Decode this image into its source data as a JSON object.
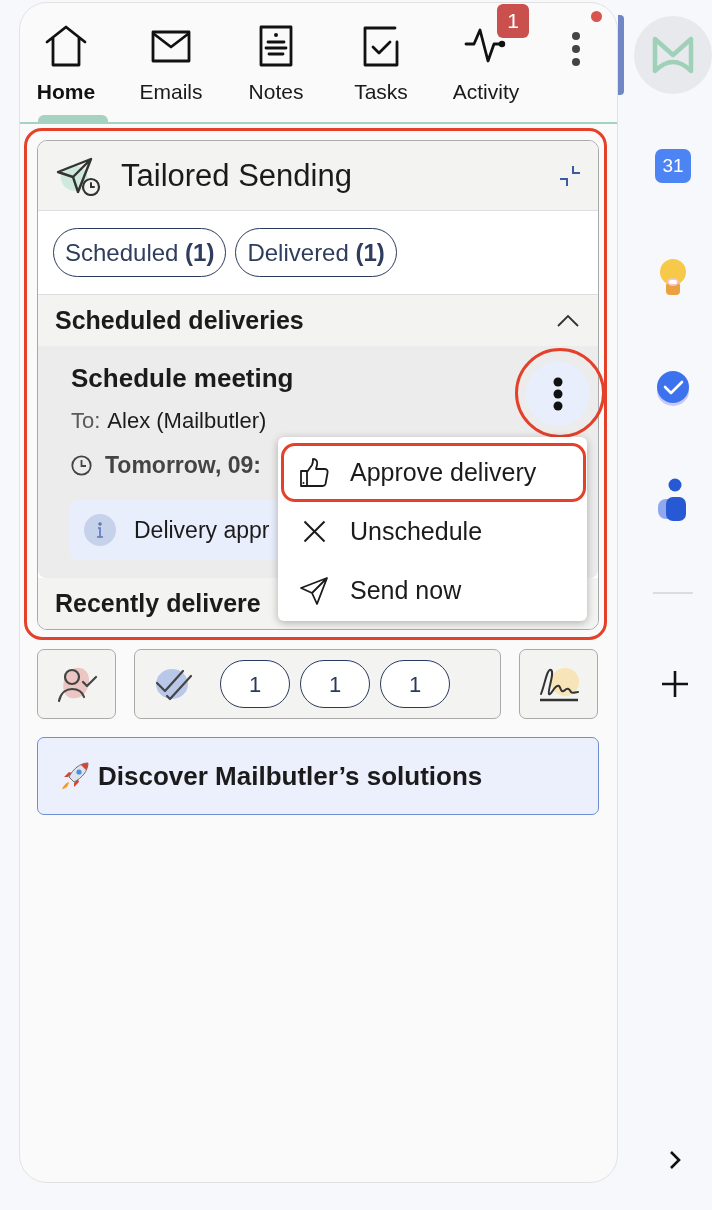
{
  "nav": {
    "tabs": [
      {
        "label": "Home",
        "selected": true
      },
      {
        "label": "Emails",
        "selected": false
      },
      {
        "label": "Notes",
        "selected": false
      },
      {
        "label": "Tasks",
        "selected": false
      },
      {
        "label": "Activity",
        "selected": false,
        "badge": "1"
      }
    ],
    "more_button": {
      "notification_dot": true
    }
  },
  "tailored_sending": {
    "title": "Tailored Sending",
    "highlighted": true,
    "filters": [
      {
        "label": "Scheduled **(1)**"
      },
      {
        "label": "Delivered **(1)**"
      }
    ],
    "scheduled_deliveries": {
      "title": "Scheduled deliveries",
      "expanded": true,
      "items": [
        {
          "title": "Schedule meeting",
          "to_label": "To:",
          "recipient": "Alex (Mailbutler)",
          "time": "Tomorrow, 09:",
          "notice": "Delivery appr",
          "menu_button": {
            "highlighted": true
          }
        }
      ]
    },
    "recently_delivered": {
      "title": "Recently delivere"
    },
    "context_menu": {
      "items": [
        {
          "kind": "approve",
          "label": "Approve delivery",
          "highlighted": true
        },
        {
          "kind": "unschedule",
          "label": "Unschedule",
          "highlighted": false
        },
        {
          "kind": "send_now",
          "label": "Send now",
          "highlighted": false
        }
      ]
    }
  },
  "toolbar": {
    "counts": [
      "1",
      "1",
      "1"
    ]
  },
  "banner": {
    "text": "Discover Mailbutler’s solutions"
  },
  "sidebar": {
    "apps": [
      {
        "kind": "mailbutler",
        "selected": true
      },
      {
        "kind": "calendar",
        "label": "31",
        "selected": false
      },
      {
        "kind": "keep",
        "selected": false
      },
      {
        "kind": "tasks",
        "selected": false
      },
      {
        "kind": "contacts",
        "selected": false
      }
    ]
  }
}
